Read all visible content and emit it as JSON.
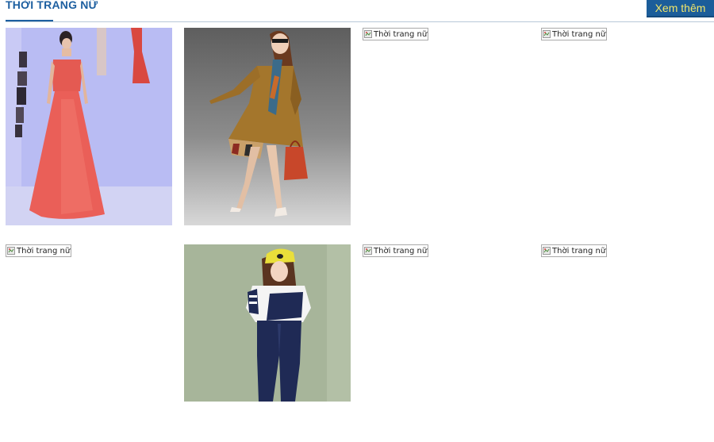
{
  "section": {
    "title": "THỜI TRANG NỮ",
    "more_label": "Xem thêm"
  },
  "products": [
    {
      "alt": "Thời trang nữ",
      "image": "red-gown-runway-photo"
    },
    {
      "alt": "Thời trang nữ",
      "image": "brown-trench-coat-photo"
    },
    {
      "alt": "Thời trang nữ",
      "image": "broken-image"
    },
    {
      "alt": "Thời trang nữ",
      "image": "broken-image"
    },
    {
      "alt": "Thời trang nữ",
      "image": "broken-image"
    },
    {
      "alt": "Thời trang nữ",
      "image": "navy-jumpsuit-yellow-cap-photo"
    },
    {
      "alt": "Thời trang nữ",
      "image": "broken-image"
    },
    {
      "alt": "Thời trang nữ",
      "image": "broken-image"
    }
  ]
}
